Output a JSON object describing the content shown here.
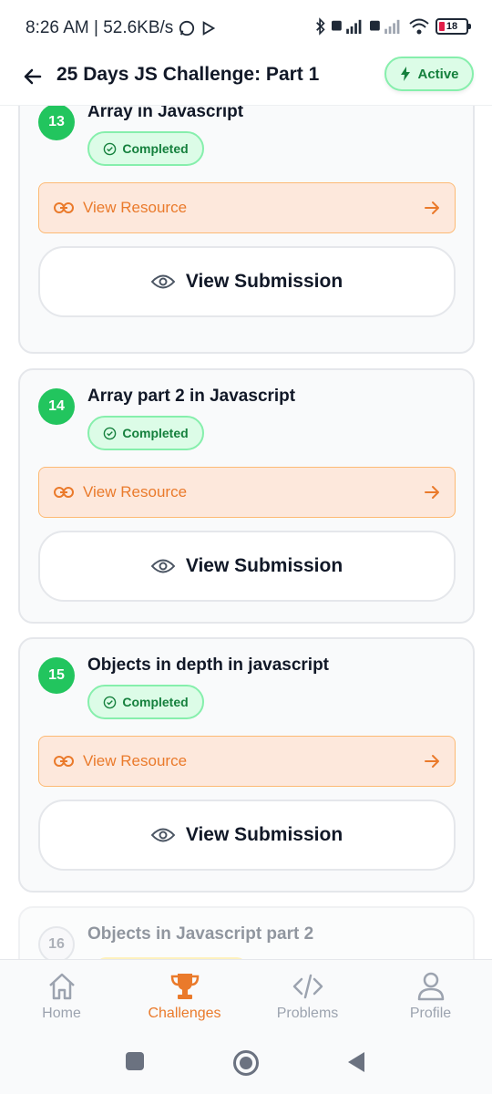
{
  "status_bar": {
    "time": "8:26 AM | 52.6KB/s",
    "battery": "18"
  },
  "header": {
    "title": "25 Days JS Challenge: Part 1",
    "status_label": "Active"
  },
  "days": [
    {
      "number": "13",
      "title": "Array in Javascript",
      "status": "Completed",
      "resource_label": "View Resource",
      "submission_label": "View Submission"
    },
    {
      "number": "14",
      "title": "Array part 2 in Javascript",
      "status": "Completed",
      "resource_label": "View Resource",
      "submission_label": "View Submission"
    },
    {
      "number": "15",
      "title": "Objects in depth in javascript",
      "status": "Completed",
      "resource_label": "View Resource",
      "submission_label": "View Submission"
    },
    {
      "number": "16",
      "title": "Objects in Javascript part 2"
    }
  ],
  "bottom_nav": {
    "items": [
      {
        "label": "Home",
        "icon": "home-icon",
        "active": false
      },
      {
        "label": "Challenges",
        "icon": "trophy-icon",
        "active": true
      },
      {
        "label": "Problems",
        "icon": "code-icon",
        "active": false
      },
      {
        "label": "Profile",
        "icon": "user-icon",
        "active": false
      }
    ]
  },
  "colors": {
    "accent": "#ea7a2b",
    "success": "#22c55e",
    "success_text": "#15803d"
  }
}
